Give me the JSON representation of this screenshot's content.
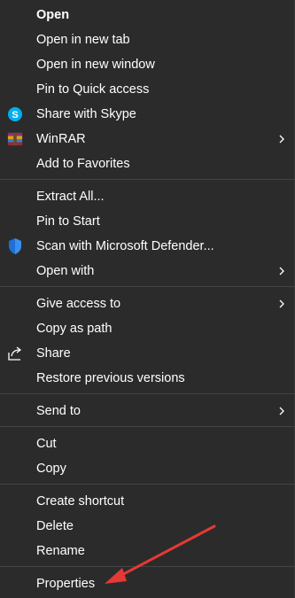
{
  "menu": {
    "items": [
      {
        "label": "Open"
      },
      {
        "label": "Open in new tab"
      },
      {
        "label": "Open in new window"
      },
      {
        "label": "Pin to Quick access"
      },
      {
        "label": "Share with Skype",
        "icon": "skype-icon"
      },
      {
        "label": "WinRAR",
        "icon": "winrar-icon",
        "submenu": true
      },
      {
        "label": "Add to Favorites"
      },
      {
        "label": "Extract All..."
      },
      {
        "label": "Pin to Start"
      },
      {
        "label": "Scan with Microsoft Defender...",
        "icon": "defender-shield-icon"
      },
      {
        "label": "Open with",
        "submenu": true
      },
      {
        "label": "Give access to",
        "submenu": true
      },
      {
        "label": "Copy as path"
      },
      {
        "label": "Share",
        "icon": "share-icon"
      },
      {
        "label": "Restore previous versions"
      },
      {
        "label": "Send to",
        "submenu": true
      },
      {
        "label": "Cut"
      },
      {
        "label": "Copy"
      },
      {
        "label": "Create shortcut"
      },
      {
        "label": "Delete"
      },
      {
        "label": "Rename"
      },
      {
        "label": "Properties"
      }
    ]
  },
  "colors": {
    "background": "#2b2b2b",
    "text": "#ffffff",
    "separator": "#444444",
    "annotation_arrow": "#e53935"
  }
}
